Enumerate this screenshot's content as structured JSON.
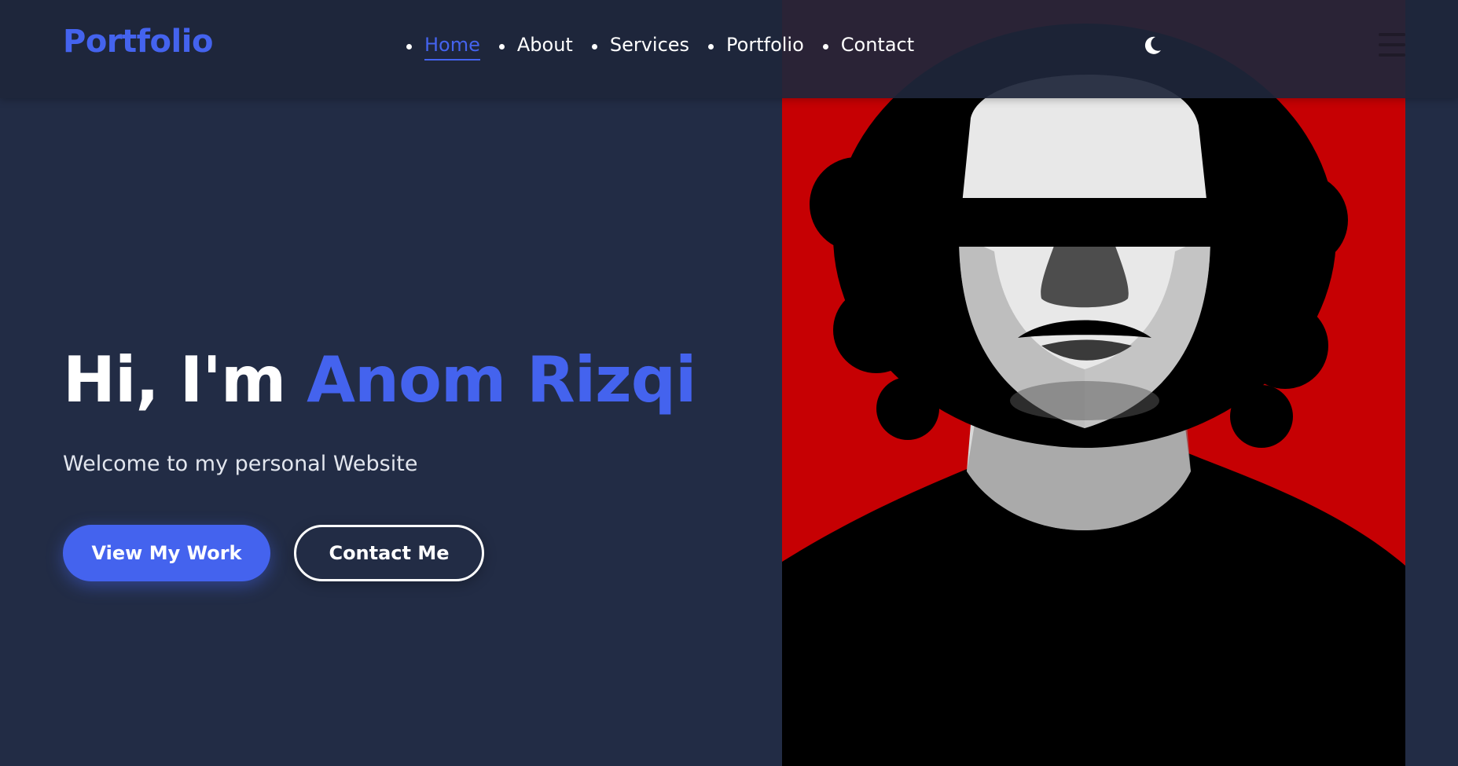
{
  "brand": {
    "logo": "Portfolio"
  },
  "nav": {
    "items": [
      {
        "label": "Home",
        "active": true
      },
      {
        "label": "About",
        "active": false
      },
      {
        "label": "Services",
        "active": false
      },
      {
        "label": "Portfolio",
        "active": false
      },
      {
        "label": "Contact",
        "active": false
      }
    ],
    "theme_toggle_icon": "moon-icon",
    "menu_icon": "hamburger-menu-icon"
  },
  "hero": {
    "greeting": "Hi, I'm",
    "name": "Anom Rizqi",
    "subtitle": "Welcome to my personal Website",
    "primary_button": "View My Work",
    "secondary_button": "Contact Me",
    "portrait_alt": "portrait-photo"
  },
  "colors": {
    "background": "#222c45",
    "accent": "#4463ee",
    "text": "#ffffff",
    "portrait_bg": "#c60003"
  }
}
